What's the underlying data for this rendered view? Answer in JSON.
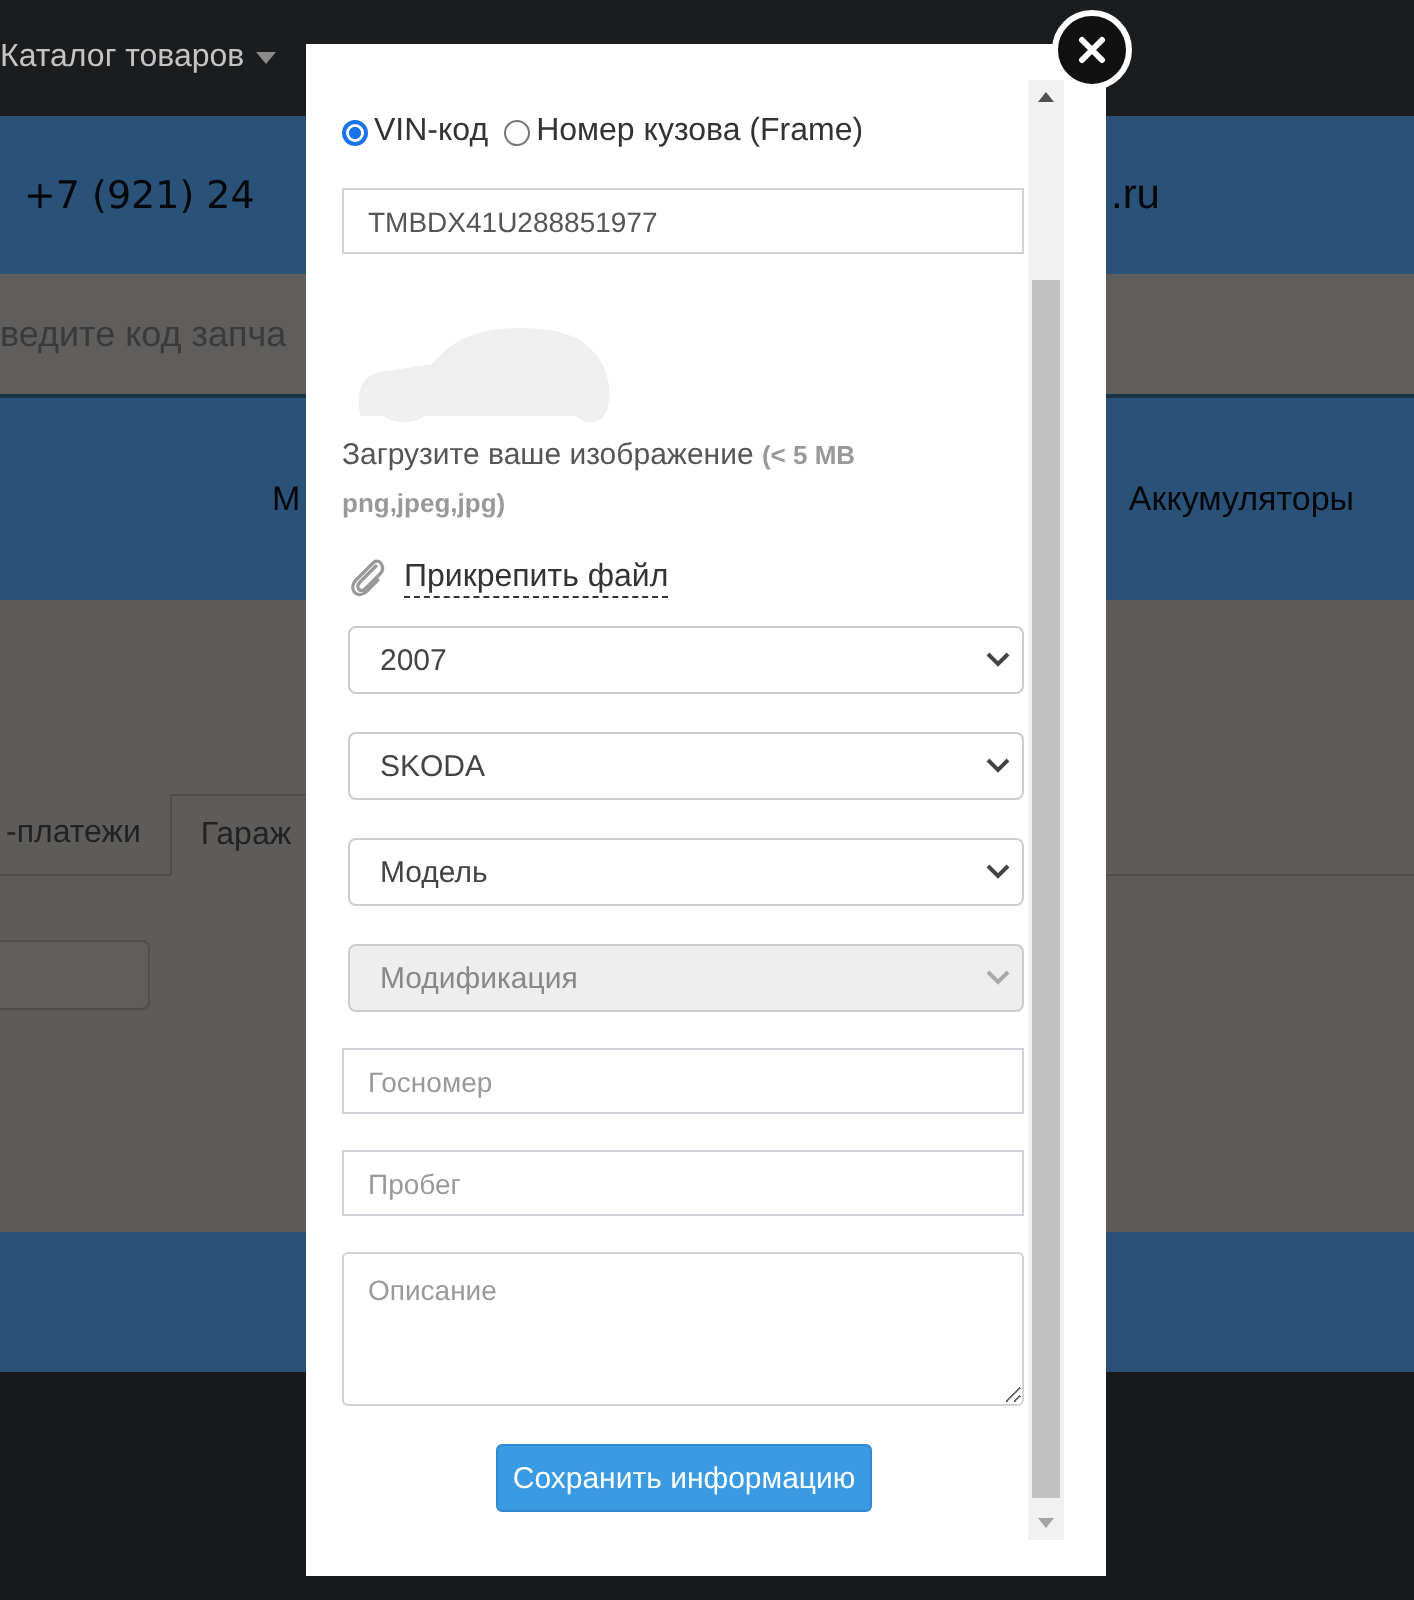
{
  "background": {
    "nav_item": "Каталог товаров",
    "phone": "+7 (921) 24",
    "site_suffix": ".ru",
    "search_placeholder": "ведите код запча",
    "menu_items": [
      "М",
      "Аккумуляторы"
    ],
    "tabs": [
      {
        "label": "-платежи",
        "selected": false
      },
      {
        "label": "Гараж",
        "selected": true
      }
    ]
  },
  "modal": {
    "radios": [
      {
        "label": "VIN-код",
        "selected": true
      },
      {
        "label": "Номер кузова (Frame)",
        "selected": false
      }
    ],
    "vin_value": "TMBDX41U288851977",
    "upload_text": "Загрузите ваше изображение **(< 5 MB png,jpeg,jpg)**",
    "attach_link": "Прикрепить файл",
    "selects": [
      {
        "value": "2007",
        "disabled": false
      },
      {
        "value": "SKODA",
        "disabled": false
      },
      {
        "value": "Модель",
        "disabled": false
      },
      {
        "value": "Модификация",
        "disabled": true
      }
    ],
    "inputs": [
      {
        "placeholder": "Госномер"
      },
      {
        "placeholder": "Пробег"
      }
    ],
    "textarea": {
      "placeholder": "Описание"
    },
    "save_button": "Сохранить информацию"
  }
}
